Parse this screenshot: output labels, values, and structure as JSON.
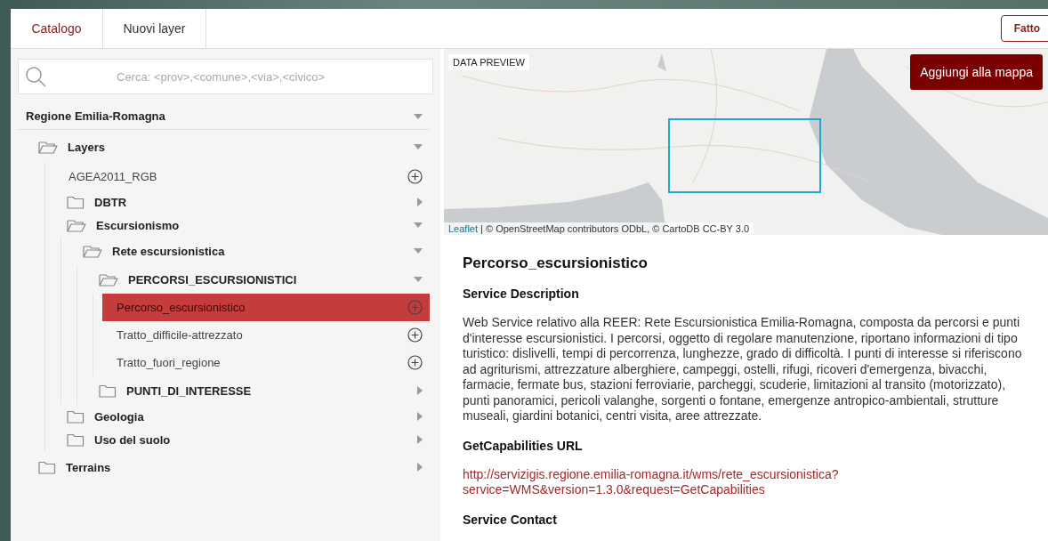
{
  "tabs": [
    {
      "label": "Catalogo",
      "selected": true
    },
    {
      "label": "Nuovi layer",
      "selected": false
    }
  ],
  "done_button": {
    "label": "Fatto"
  },
  "search": {
    "placeholder": "Cerca: <prov>,<comune>,<via>,<civico>"
  },
  "tree": {
    "label": "Regione Emilia-Romagna",
    "kind": "root",
    "expanded": true,
    "children": [
      {
        "label": "Layers",
        "kind": "folder",
        "expanded": true,
        "children": [
          {
            "label": "AGEA2011_RGB",
            "kind": "layer",
            "selected": false
          },
          {
            "label": "DBTR",
            "kind": "folder",
            "expanded": false
          },
          {
            "label": "Escursionismo",
            "kind": "folder",
            "expanded": true,
            "children": [
              {
                "label": "Rete escursionistica",
                "kind": "folder",
                "expanded": true,
                "children": [
                  {
                    "label": "PERCORSI_ESCURSIONISTICI",
                    "kind": "folder",
                    "expanded": true,
                    "children": [
                      {
                        "label": "Percorso_escursionistico",
                        "kind": "layer",
                        "selected": true
                      },
                      {
                        "label": "Tratto_difficile-attrezzato",
                        "kind": "layer",
                        "selected": false
                      },
                      {
                        "label": "Tratto_fuori_regione",
                        "kind": "layer",
                        "selected": false
                      }
                    ]
                  },
                  {
                    "label": "PUNTI_DI_INTERESSE",
                    "kind": "folder",
                    "expanded": false
                  }
                ]
              }
            ]
          },
          {
            "label": "Geologia",
            "kind": "folder",
            "expanded": false
          },
          {
            "label": "Uso del suolo",
            "kind": "folder",
            "expanded": false
          }
        ]
      },
      {
        "label": "Terrains",
        "kind": "folder",
        "expanded": false
      }
    ]
  },
  "preview": {
    "label": "DATA PREVIEW",
    "add_button": "Aggiungi alla mappa",
    "attribution_link": "Leaflet",
    "attribution": "| © OpenStreetMap contributors ODbL, © CartoDB CC-BY 3.0"
  },
  "details": {
    "title": "Percorso_escursionistico",
    "sections": [
      {
        "heading": "Service Description",
        "kind": "text",
        "body": "Web Service relativo alla REER: Rete Escursionistica Emilia-Romagna, composta da percorsi e punti d'interesse escursionistici. I percorsi, oggetto di regolare manutenzione, riportano informazioni di tipo turistico: dislivelli, tempi di percorrenza, lunghezze, grado di difficoltà. I punti di interesse si riferiscono ad agriturismi, attrezzature alberghiere, campeggi, ostelli, rifugi, ricoveri d'emergenza, bivacchi, farmacie, fermate bus, stazioni ferroviarie, parcheggi, scuderie, limitazioni al transito (motorizzato), punti panoramici, pericoli valanghe, sorgenti o fontane, emergenze antropico-ambientali, strutture museali, giardini botanici, centri visita, aree attrezzate."
      },
      {
        "heading": "GetCapabilities URL",
        "kind": "link",
        "body": "http://servizigis.regione.emilia-romagna.it/wms/rete_escursionistica?service=WMS&version=1.3.0&request=GetCapabilities"
      },
      {
        "heading": "Service Contact"
      }
    ]
  }
}
